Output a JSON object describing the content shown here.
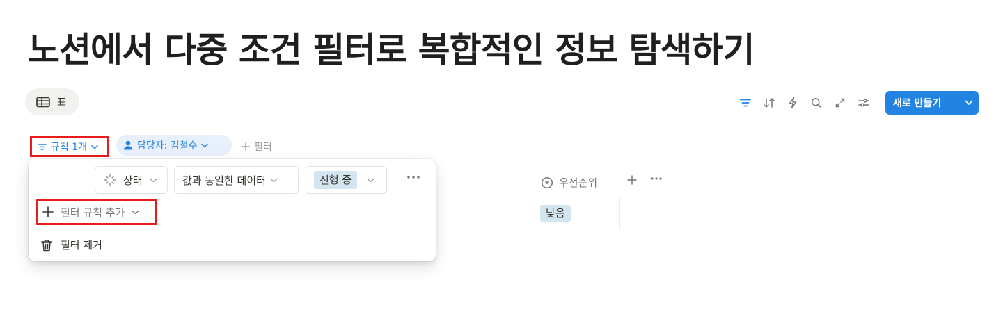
{
  "page": {
    "title": "노션에서 다중 조건 필터로 복합적인 정보 탐색하기"
  },
  "view": {
    "tab_label": "표",
    "tab_icon": "table-icon"
  },
  "toolbar": {
    "icons": [
      "filter-icon",
      "sort-icon",
      "automation-icon",
      "search-icon",
      "expand-icon",
      "settings-icon"
    ],
    "new_button_label": "새로 만들기",
    "accent_color": "#2383e2"
  },
  "filter_bar": {
    "rule_chip_label": "규칙 1개",
    "person_chip_label": "담당자: 김철수",
    "add_filter_label": "필터"
  },
  "table": {
    "priority_header": "우선순위",
    "priority_value": "낮음"
  },
  "filter_popup": {
    "property_label": "상태",
    "condition_label": "값과 동일한 데이터",
    "value_label": "진행 중",
    "add_rule_label": "필터 규칙 추가",
    "remove_label": "필터 제거"
  },
  "annotation": {
    "highlight_color": "#e81c1c"
  }
}
